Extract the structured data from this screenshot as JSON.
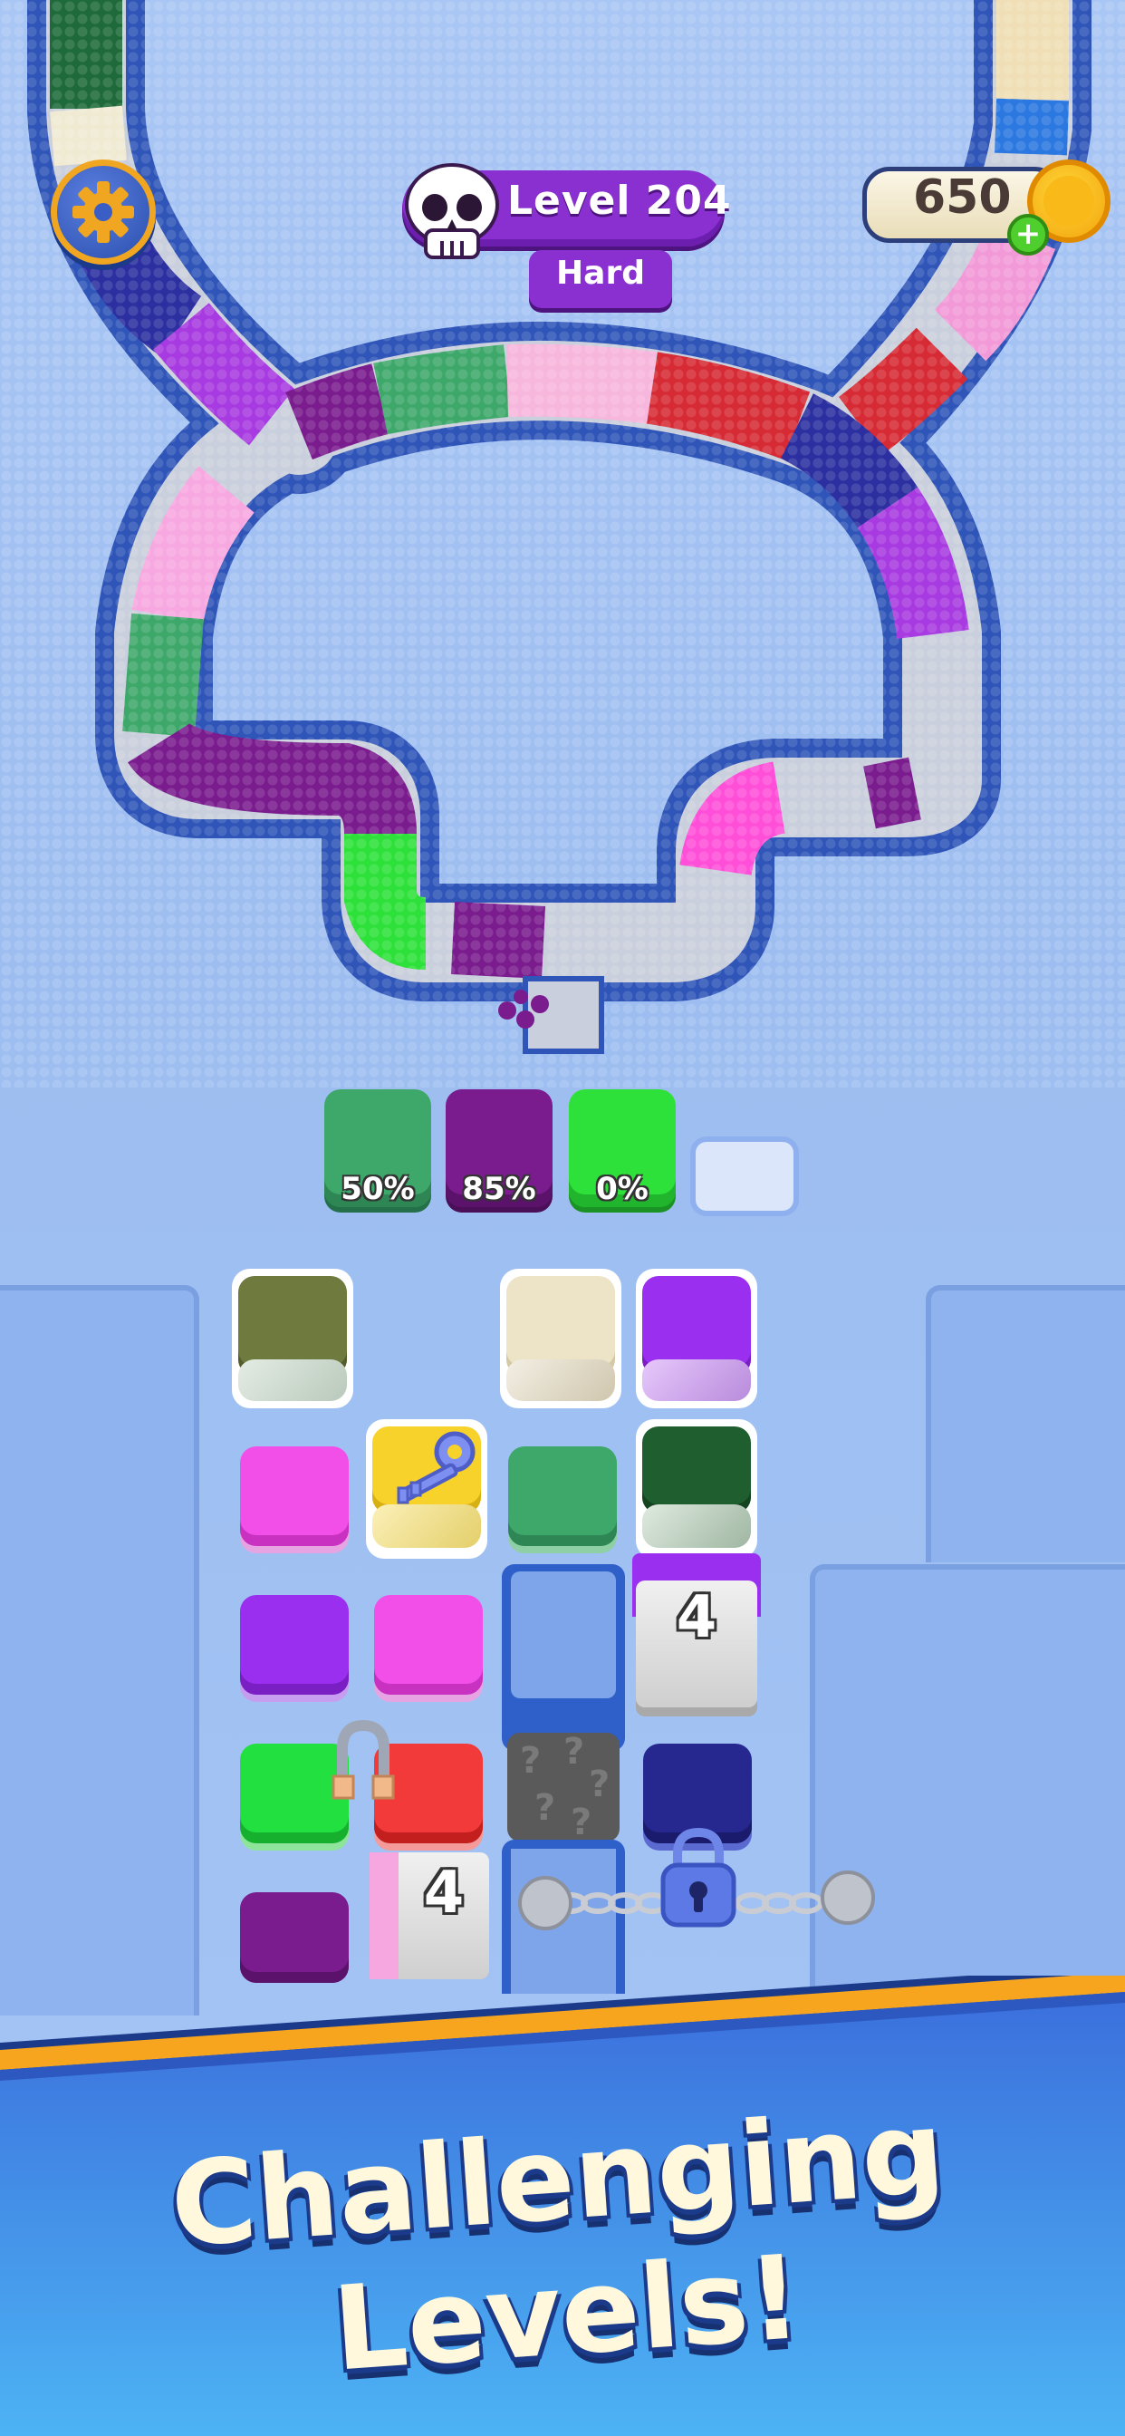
{
  "hud": {
    "level_label": "Level 204",
    "difficulty": "Hard",
    "coins": "650",
    "plus_symbol": "+",
    "settings_icon": "gear-icon",
    "skull_icon": "skull-icon",
    "coin_icon": "coin-icon"
  },
  "collectors": [
    {
      "color": "#3ea86a",
      "percent": "50%"
    },
    {
      "color": "#7a1c8e",
      "percent": "85%"
    },
    {
      "color": "#2ee13a",
      "percent": "0%"
    },
    {
      "color": "",
      "percent": ""
    }
  ],
  "board": {
    "counter_tiles": [
      "4",
      "4"
    ],
    "key_icon": "key-icon",
    "lock_icon": "padlock-icon",
    "magnet_icon": "magnet-icon",
    "mystery_icon": "question-mark-icon"
  },
  "colors": {
    "olive": "#6f7a3e",
    "cream": "#ede4c8",
    "purple": "#9b2ff0",
    "magenta": "#f24fe8",
    "yellow": "#f7d22a",
    "teal": "#3ea86a",
    "darkgreen": "#1f5e2e",
    "violet": "#9b2ff0",
    "lime": "#22e040",
    "red": "#f23a3a",
    "navy": "#27288f",
    "plum": "#7a1c8e"
  },
  "banner": {
    "headline": "Challenging Levels!"
  }
}
